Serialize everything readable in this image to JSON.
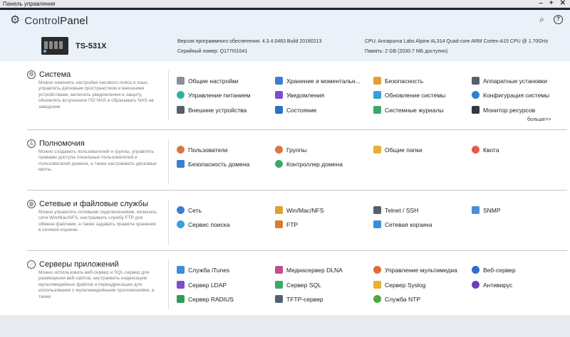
{
  "window": {
    "title": "Панель управления",
    "controls": [
      "–",
      "+",
      "✕"
    ]
  },
  "header": {
    "brand_prefix": "Control",
    "brand_suffix": "Panel",
    "search_icon": "search-icon",
    "help_icon": "help-icon",
    "model": "TS-531X",
    "fw_label": "Версия программного обеспечения:",
    "fw_value": "4.3.4.0483 Build 20180213",
    "serial_label": "Серийный номер:",
    "serial_value": "Q177I01041",
    "cpu_label": "CPU:",
    "cpu_value": "Annapurna Labs Alpine AL314 Quad-core ARM Cortex-A15 CPU @ 1.70GHz",
    "mem_label": "Память:",
    "mem_value": "2 GB (2030.7 МБ доступно)"
  },
  "sections": [
    {
      "title": "Система",
      "icon": "gear-icon",
      "desc": "Можно изменять настройки часового пояса и язык, управлять дисковым пространством и внешними устройствами, включать уведомления и защиту, обновлять встроенное ПО NAS и сбрасывать NAS на заводские",
      "items": [
        {
          "label": "Общие настройки",
          "icon": "general-settings-icon",
          "color": "#8a8f99"
        },
        {
          "label": "Хранение и моментальн...",
          "icon": "storage-icon",
          "color": "#3b7fd1"
        },
        {
          "label": "Безопасность",
          "icon": "security-icon",
          "color": "#e0a030"
        },
        {
          "label": "Аппаратные установки",
          "icon": "hardware-icon",
          "color": "#5a5f6a"
        },
        {
          "label": "Управление питанием",
          "icon": "power-icon",
          "color": "#2bb3a0"
        },
        {
          "label": "Уведомления",
          "icon": "notifications-icon",
          "color": "#7c4dcc"
        },
        {
          "label": "Обновление системы",
          "icon": "update-icon",
          "color": "#3aa0d8"
        },
        {
          "label": "Конфигурация системы",
          "icon": "config-icon",
          "color": "#2f7fd0"
        },
        {
          "label": "Внешние устройства",
          "icon": "external-devices-icon",
          "color": "#55606f"
        },
        {
          "label": "Состояние",
          "icon": "status-icon",
          "color": "#2f6fc4"
        },
        {
          "label": "Системные журналы",
          "icon": "logs-icon",
          "color": "#3aa86a"
        },
        {
          "label": "Монитор ресурсов",
          "icon": "resource-monitor-icon",
          "color": "#333a44"
        }
      ],
      "more": "больше>>"
    },
    {
      "title": "Полномочия",
      "icon": "user-icon",
      "desc": "Можно создавать пользователей и группы, управлять правами доступа локальных пользователей и пользователей домена, а также настраивать дисковые квоты.",
      "items": [
        {
          "label": "Пользователи",
          "icon": "users-icon",
          "color": "#d9783c"
        },
        {
          "label": "Группы",
          "icon": "groups-icon",
          "color": "#d9783c"
        },
        {
          "label": "Общие папки",
          "icon": "shared-folders-icon",
          "color": "#e8b030"
        },
        {
          "label": "Квота",
          "icon": "quota-icon",
          "color": "#e25d4a"
        },
        {
          "label": "Безопасность домена",
          "icon": "domain-security-icon",
          "color": "#3b7fd1"
        },
        {
          "label": "Контроллер домена",
          "icon": "domain-controller-icon",
          "color": "#3aa86a"
        }
      ]
    },
    {
      "title": "Сетевые и файловые службы",
      "icon": "globe-icon",
      "desc": "Можно управлять сетевыми подключениями, включать сети Win/Mac/NFS, настраивать службу FTP для обмена файлами, а также задавать правила хранения в сетевой корзине.",
      "items": [
        {
          "label": "Сеть",
          "icon": "network-icon",
          "color": "#3b7fd1"
        },
        {
          "label": "Win/Mac/NFS",
          "icon": "win-mac-nfs-icon",
          "color": "#e0a030"
        },
        {
          "label": "Telnet / SSH",
          "icon": "telnet-ssh-icon",
          "color": "#55606f"
        },
        {
          "label": "SNMP",
          "icon": "snmp-icon",
          "color": "#4a8fd6"
        },
        {
          "label": "Сервис поиска",
          "icon": "discovery-icon",
          "color": "#3aa0d8"
        },
        {
          "label": "FTP",
          "icon": "ftp-icon",
          "color": "#e07a30"
        },
        {
          "label": "Сетевая корзина",
          "icon": "recycle-bin-icon",
          "color": "#3b8fd6"
        }
      ]
    },
    {
      "title": "Серверы приложений",
      "icon": "apps-icon",
      "desc": "Можно использовать веб-сервер и SQL-сервер для размещения веб-сайтов, настраивать индексацию мультимедийных файлов и переадресацию для использования с мультимедийными приложениями, а также",
      "items": [
        {
          "label": "Служба iTunes",
          "icon": "itunes-icon",
          "color": "#3b8fd6"
        },
        {
          "label": "Медиасервер DLNA",
          "icon": "dlna-icon",
          "color": "#c94b8a"
        },
        {
          "label": "Управление мультимедиа",
          "icon": "multimedia-icon",
          "color": "#e06a3a"
        },
        {
          "label": "Веб-сервер",
          "icon": "web-server-icon",
          "color": "#2f6fc4"
        },
        {
          "label": "Сервер LDAP",
          "icon": "ldap-icon",
          "color": "#7c4dcc"
        },
        {
          "label": "Сервер SQL",
          "icon": "sql-icon",
          "color": "#3aa86a"
        },
        {
          "label": "Сервер Syslog",
          "icon": "syslog-icon",
          "color": "#e8b030"
        },
        {
          "label": "Антивирус",
          "icon": "antivirus-icon",
          "color": "#6a3fb8"
        },
        {
          "label": "Сервер RADIUS",
          "icon": "radius-icon",
          "color": "#2f9a5a"
        },
        {
          "label": "TFTP-сервер",
          "icon": "tftp-icon",
          "color": "#55606f"
        },
        {
          "label": "Служба NTP",
          "icon": "ntp-icon",
          "color": "#4fa83a"
        }
      ]
    }
  ]
}
